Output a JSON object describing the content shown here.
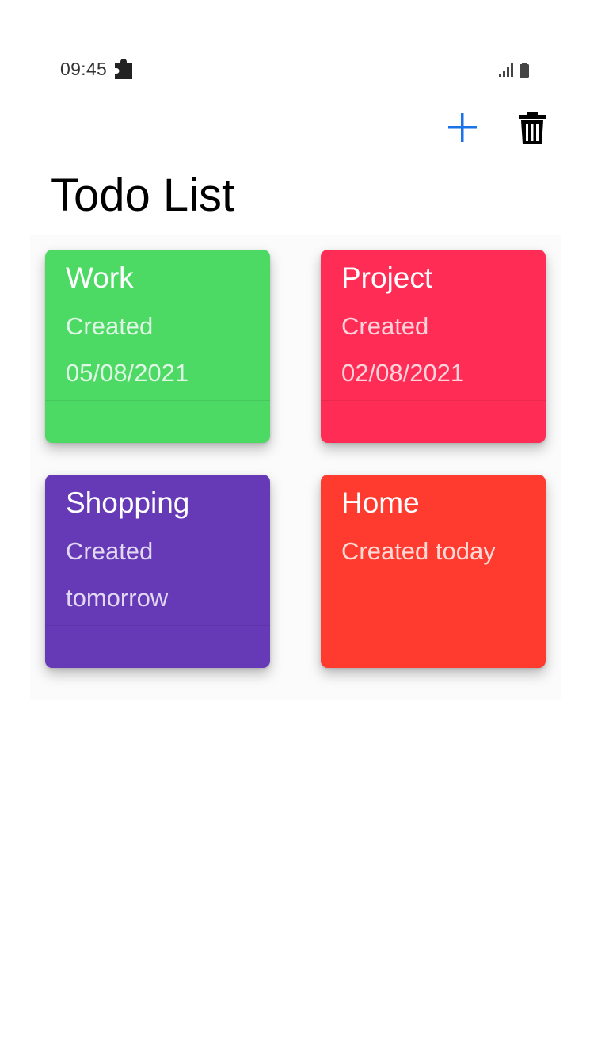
{
  "status_bar": {
    "time": "09:45",
    "notification_icon": "puzzle-piece-icon",
    "signal_icon": "signal-icon",
    "battery_icon": "battery-icon"
  },
  "toolbar": {
    "add_icon": "plus-icon",
    "delete_icon": "trash-icon",
    "add_color": "#1a73e8",
    "delete_color": "#000000"
  },
  "page": {
    "title": "Todo List"
  },
  "cards": [
    {
      "title": "Work",
      "line1": "Created",
      "line2": "05/08/2021",
      "color": "#4cd964",
      "text_color": "#dff7e4"
    },
    {
      "title": "Project",
      "line1": "Created",
      "line2": "02/08/2021",
      "color": "#ff2d55",
      "text_color": "#ffd3dc"
    },
    {
      "title": "Shopping",
      "line1": "Created",
      "line2": "tomorrow",
      "color": "#663ab7",
      "text_color": "#e2d8f2"
    },
    {
      "title": "Home",
      "line1": "Created today",
      "line2": "",
      "color": "#ff3b30",
      "text_color": "#ffd9d6"
    }
  ]
}
